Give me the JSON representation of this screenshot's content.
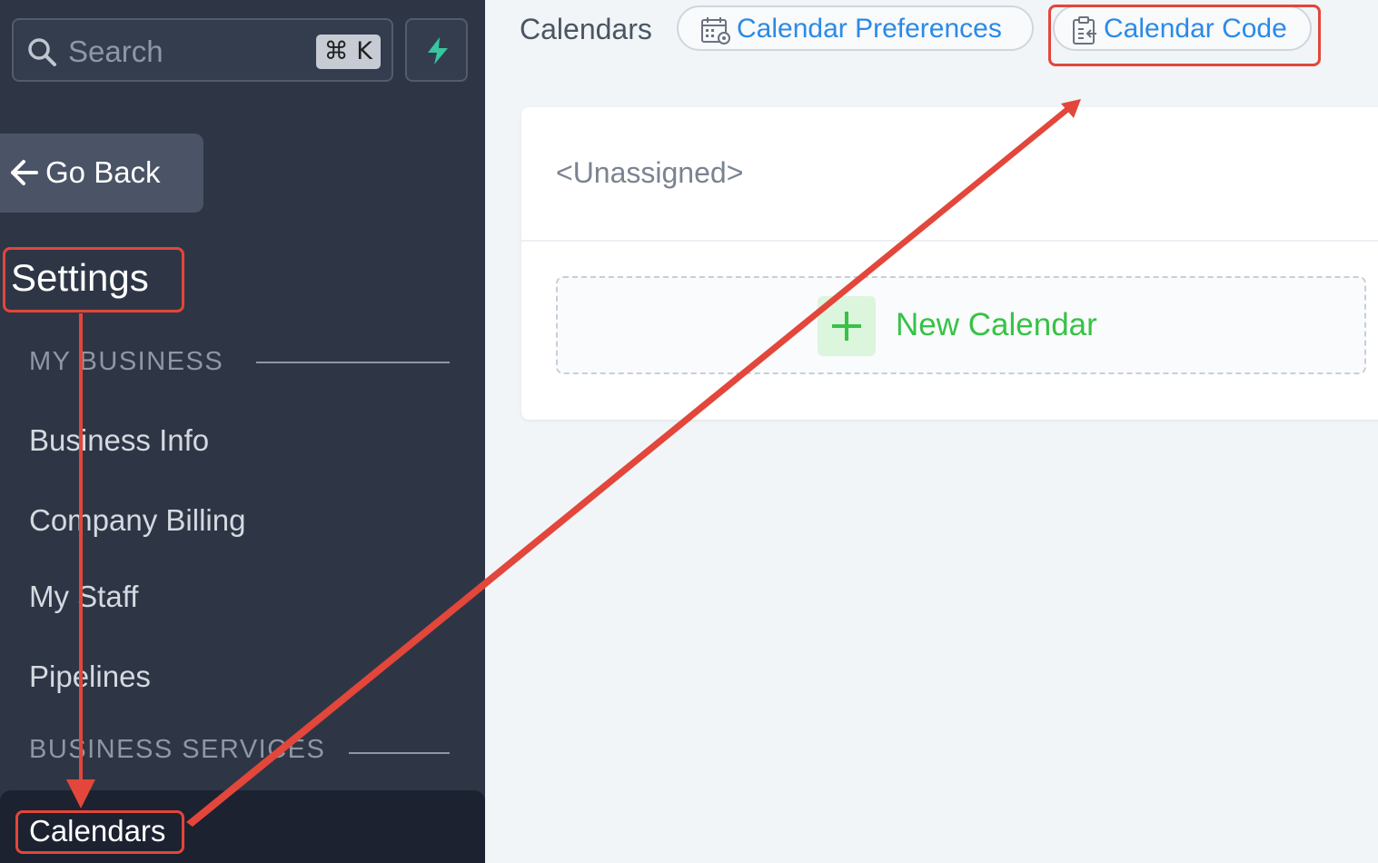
{
  "sidebar": {
    "search": {
      "placeholder": "Search",
      "shortcut": "⌘ K",
      "icon": "search-icon"
    },
    "quick_action_icon": "bolt-icon",
    "go_back_label": "Go Back",
    "title": "Settings",
    "sections": [
      {
        "label": "MY BUSINESS",
        "items": [
          {
            "label": "Business Info"
          },
          {
            "label": "Company Billing"
          },
          {
            "label": "My Staff"
          },
          {
            "label": "Pipelines"
          }
        ]
      },
      {
        "label": "BUSINESS SERVICES",
        "items": [
          {
            "label": "Calendars",
            "active": true
          }
        ]
      }
    ]
  },
  "main": {
    "title": "Calendars",
    "preferences_button": {
      "label": "Calendar Preferences",
      "icon": "calendar-settings-icon"
    },
    "code_button": {
      "label": "Calendar Code",
      "icon": "clipboard-code-icon"
    },
    "group": {
      "name": "<Unassigned>",
      "new_calendar_label": "New Calendar"
    }
  },
  "colors": {
    "sidebar_bg": "#2e3646",
    "active_item_bg": "#1c2230",
    "link_blue": "#2b8ae6",
    "success_green": "#37c246",
    "annotation_red": "#e3463a"
  }
}
